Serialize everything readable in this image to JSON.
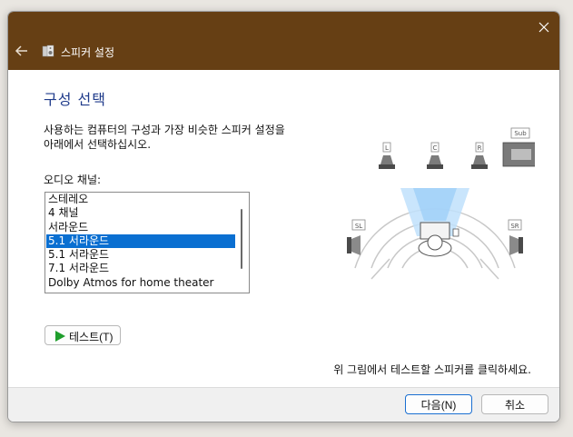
{
  "window": {
    "title": "스피커 설정",
    "titlebar_color": "#663f14"
  },
  "main": {
    "heading": "구성 선택",
    "description": "사용하는 컴퓨터의 구성과 가장 비슷한 스피커 설정을\n아래에서 선택하십시오.",
    "channel_label": "오디오 채널:",
    "channels": [
      "스테레오",
      "4 채널",
      "서라운드",
      "5.1 서라운드",
      "5.1 서라운드",
      "7.1 서라운드",
      "Dolby Atmos for home theater"
    ],
    "selected_index": 3,
    "test_button": "테스트(T)",
    "hint": "위 그림에서 테스트할 스피커를 클릭하세요."
  },
  "diagram": {
    "speakers": {
      "left": "L",
      "center": "C",
      "right": "R",
      "sub": "Sub",
      "surround_left": "SL",
      "surround_right": "SR"
    }
  },
  "footer": {
    "next_label": "다음(N)",
    "cancel_label": "취소"
  },
  "colors": {
    "selection": "#0a6fd1",
    "heading": "#1e3a8a",
    "play": "#1f9e2c"
  }
}
